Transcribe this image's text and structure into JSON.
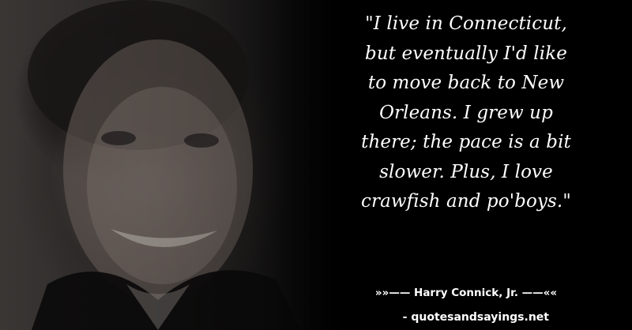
{
  "quote": {
    "lines": [
      "\"I live in Connecticut,",
      "but eventually I'd like",
      "to move back to New",
      "Orleans. I grew up",
      "there; the pace is a bit",
      "slower. Plus, I love",
      "crawfish and po'boys.\""
    ]
  },
  "author": "»»—— Harry Connick, Jr. ——««",
  "source": "- quotesandsayings.net",
  "colors": {
    "background": "#000000",
    "text": "#ffffff"
  }
}
